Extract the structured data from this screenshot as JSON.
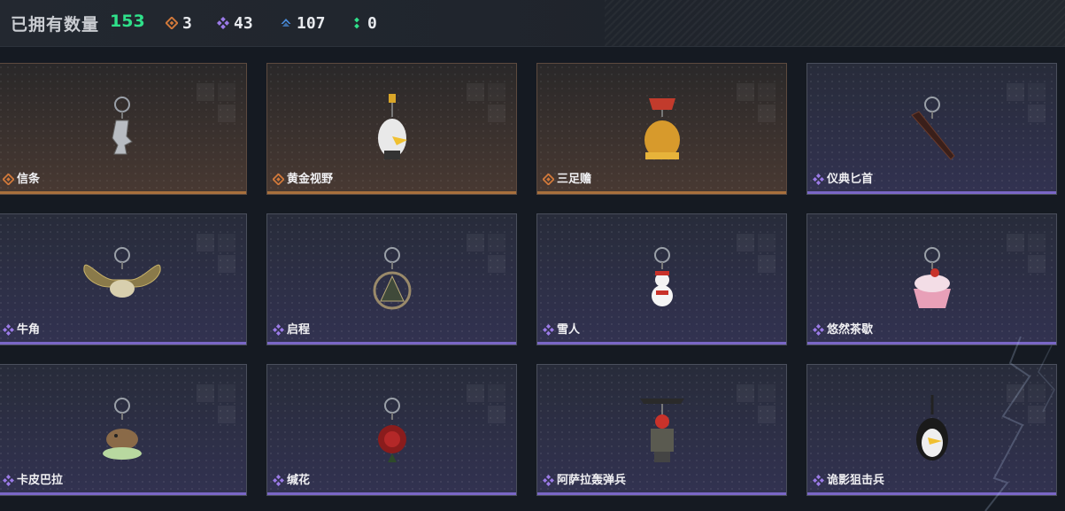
{
  "header": {
    "owned_label": "已拥有数量",
    "owned_count": "153",
    "stats": [
      {
        "rarity": "orange",
        "icon": "orange-diamond-icon",
        "value": "3"
      },
      {
        "rarity": "purple",
        "icon": "purple-diamond-icon",
        "value": "43"
      },
      {
        "rarity": "blue",
        "icon": "blue-chevron-icon",
        "value": "107"
      },
      {
        "rarity": "green",
        "icon": "green-dots-icon",
        "value": "0"
      }
    ]
  },
  "colors": {
    "orange": "#d0783a",
    "purple": "#9b7ae8",
    "blue": "#4a8ee0",
    "green": "#2fe08a"
  },
  "items": [
    {
      "name": "信条",
      "rarity": "orange",
      "icon": "keychain-trophy-icon"
    },
    {
      "name": "黄金视野",
      "rarity": "orange",
      "icon": "keychain-eagle-icon"
    },
    {
      "name": "三足赡",
      "rarity": "orange",
      "icon": "keychain-golden-toad-icon"
    },
    {
      "name": "仪典匕首",
      "rarity": "purple",
      "icon": "keychain-dagger-icon"
    },
    {
      "name": "牛角",
      "rarity": "purple",
      "icon": "keychain-horns-icon"
    },
    {
      "name": "启程",
      "rarity": "purple",
      "icon": "keychain-medallion-icon"
    },
    {
      "name": "雪人",
      "rarity": "purple",
      "icon": "keychain-snowman-icon"
    },
    {
      "name": "悠然茶歇",
      "rarity": "purple",
      "icon": "keychain-cupcake-icon"
    },
    {
      "name": "卡皮巴拉",
      "rarity": "purple",
      "icon": "keychain-capybara-icon"
    },
    {
      "name": "缄花",
      "rarity": "purple",
      "icon": "keychain-rose-icon"
    },
    {
      "name": "阿萨拉轰弹兵",
      "rarity": "purple",
      "icon": "keychain-soldier-icon"
    },
    {
      "name": "诡影狙击兵",
      "rarity": "purple",
      "icon": "keychain-penguin-icon"
    }
  ]
}
